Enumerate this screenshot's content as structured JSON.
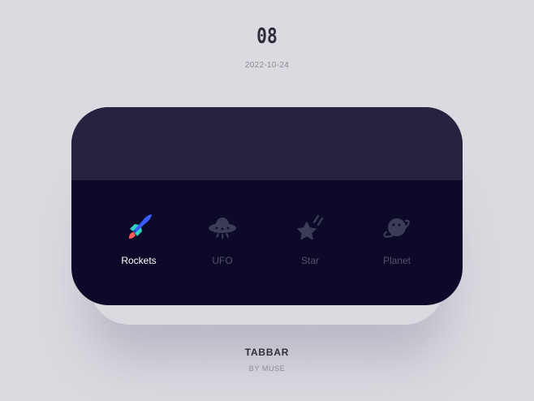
{
  "header": {
    "number": "08",
    "date": "2022-10-24"
  },
  "tabbar": {
    "active_color": "#ffffff",
    "inactive_color": "#55546a",
    "tabs": [
      {
        "label": "Rockets",
        "icon": "rocket-icon",
        "active": true
      },
      {
        "label": "UFO",
        "icon": "ufo-icon",
        "active": false
      },
      {
        "label": "Star",
        "icon": "star-icon",
        "active": false
      },
      {
        "label": "Planet",
        "icon": "planet-icon",
        "active": false
      }
    ]
  },
  "footer": {
    "title": "TABBAR",
    "subtitle": "BY MUSE"
  },
  "colors": {
    "background": "#dadae0",
    "card_top": "#252340",
    "card_bottom": "#0c0a28",
    "rocket_blue": "#3a5bff",
    "rocket_cyan": "#2ed3c6",
    "rocket_flame": "#ff5a5a"
  }
}
